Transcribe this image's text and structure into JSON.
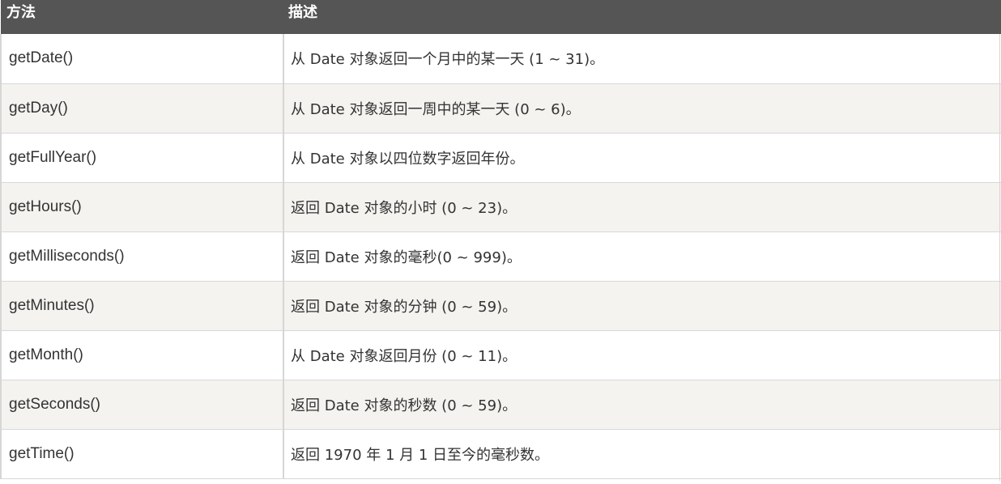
{
  "table": {
    "headers": {
      "method": "方法",
      "description": "描述"
    },
    "rows": [
      {
        "method": "getDate()",
        "description": "从 Date 对象返回一个月中的某一天 (1 ~ 31)。"
      },
      {
        "method": "getDay()",
        "description": "从 Date 对象返回一周中的某一天 (0 ~ 6)。"
      },
      {
        "method": "getFullYear()",
        "description": "从 Date 对象以四位数字返回年份。"
      },
      {
        "method": "getHours()",
        "description": "返回 Date 对象的小时 (0 ~ 23)。"
      },
      {
        "method": "getMilliseconds()",
        "description": "返回 Date 对象的毫秒(0 ~ 999)。"
      },
      {
        "method": "getMinutes()",
        "description": "返回 Date 对象的分钟 (0 ~ 59)。"
      },
      {
        "method": "getMonth()",
        "description": "从 Date 对象返回月份 (0 ~ 11)。"
      },
      {
        "method": "getSeconds()",
        "description": "返回 Date 对象的秒数 (0 ~ 59)。"
      },
      {
        "method": "getTime()",
        "description": "返回 1970 年 1 月 1 日至今的毫秒数。"
      }
    ]
  },
  "colors": {
    "header_bg": "#555555",
    "header_text": "#ffffff",
    "row_alt_bg": "#f4f3f0",
    "body_text": "#333333"
  }
}
